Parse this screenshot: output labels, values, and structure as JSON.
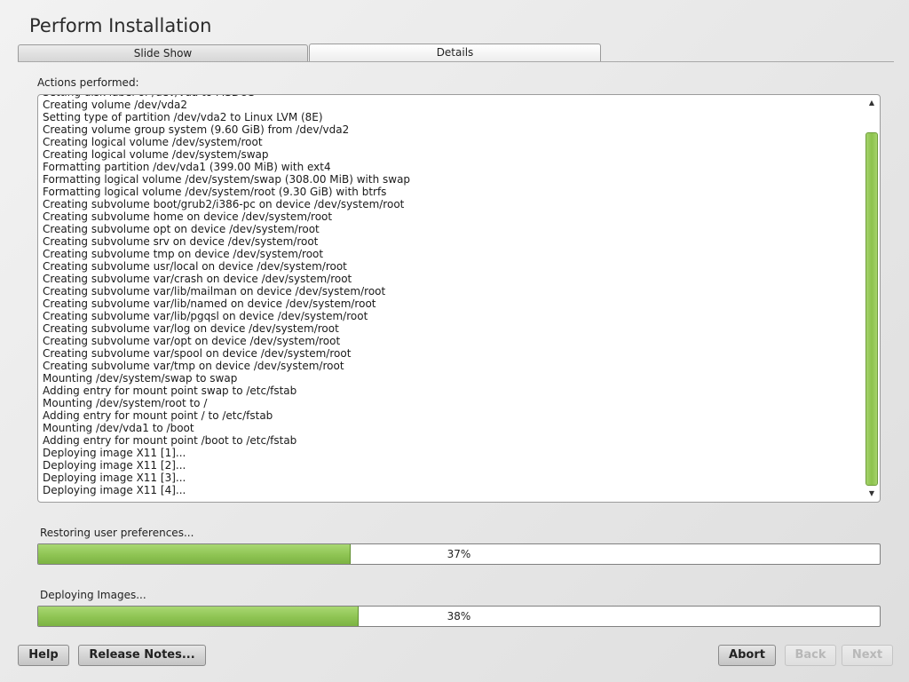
{
  "page_title": "Perform Installation",
  "tabs": [
    {
      "label": "Slide Show",
      "active": false
    },
    {
      "label": "Details",
      "active": true
    }
  ],
  "actions_label": "Actions performed:",
  "log": [
    "Setting disk label of /dev/vda to MSDOS",
    "Creating volume /dev/vda2",
    "Setting type of partition /dev/vda2 to Linux LVM (8E)",
    "Creating volume group system (9.60 GiB) from /dev/vda2",
    "Creating logical volume /dev/system/root",
    "Creating logical volume /dev/system/swap",
    "Formatting partition /dev/vda1 (399.00 MiB) with ext4",
    "Formatting logical volume /dev/system/swap (308.00 MiB) with swap",
    "Formatting logical volume /dev/system/root (9.30 GiB) with btrfs",
    "Creating subvolume boot/grub2/i386-pc on device /dev/system/root",
    "Creating subvolume home on device /dev/system/root",
    "Creating subvolume opt on device /dev/system/root",
    "Creating subvolume srv on device /dev/system/root",
    "Creating subvolume tmp on device /dev/system/root",
    "Creating subvolume usr/local on device /dev/system/root",
    "Creating subvolume var/crash on device /dev/system/root",
    "Creating subvolume var/lib/mailman on device /dev/system/root",
    "Creating subvolume var/lib/named on device /dev/system/root",
    "Creating subvolume var/lib/pgqsl on device /dev/system/root",
    "Creating subvolume var/log on device /dev/system/root",
    "Creating subvolume var/opt on device /dev/system/root",
    "Creating subvolume var/spool on device /dev/system/root",
    "Creating subvolume var/tmp on device /dev/system/root",
    "Mounting /dev/system/swap to swap",
    "Adding entry for mount point swap to /etc/fstab",
    "Mounting /dev/system/root to /",
    "Adding entry for mount point / to /etc/fstab",
    "Mounting /dev/vda1 to /boot",
    "Adding entry for mount point /boot to /etc/fstab",
    "Deploying image X11 [1]...",
    "Deploying image X11 [2]...",
    "Deploying image X11 [3]...",
    "Deploying image X11 [4]..."
  ],
  "scrollbar": {
    "up_icon": "up-arrow-icon",
    "down_icon": "down-arrow-icon",
    "accent": "#8cc24c"
  },
  "progress1": {
    "label": "Restoring user preferences...",
    "percent": 37,
    "text": "37%"
  },
  "progress2": {
    "label": "Deploying Images...",
    "percent": 38,
    "text": "38%"
  },
  "buttons": {
    "help": "Help",
    "release_notes": "Release Notes...",
    "abort": "Abort",
    "back": "Back",
    "next": "Next"
  },
  "colors": {
    "progress_fill": "#8ec453",
    "accent_green": "#8cc24c"
  }
}
